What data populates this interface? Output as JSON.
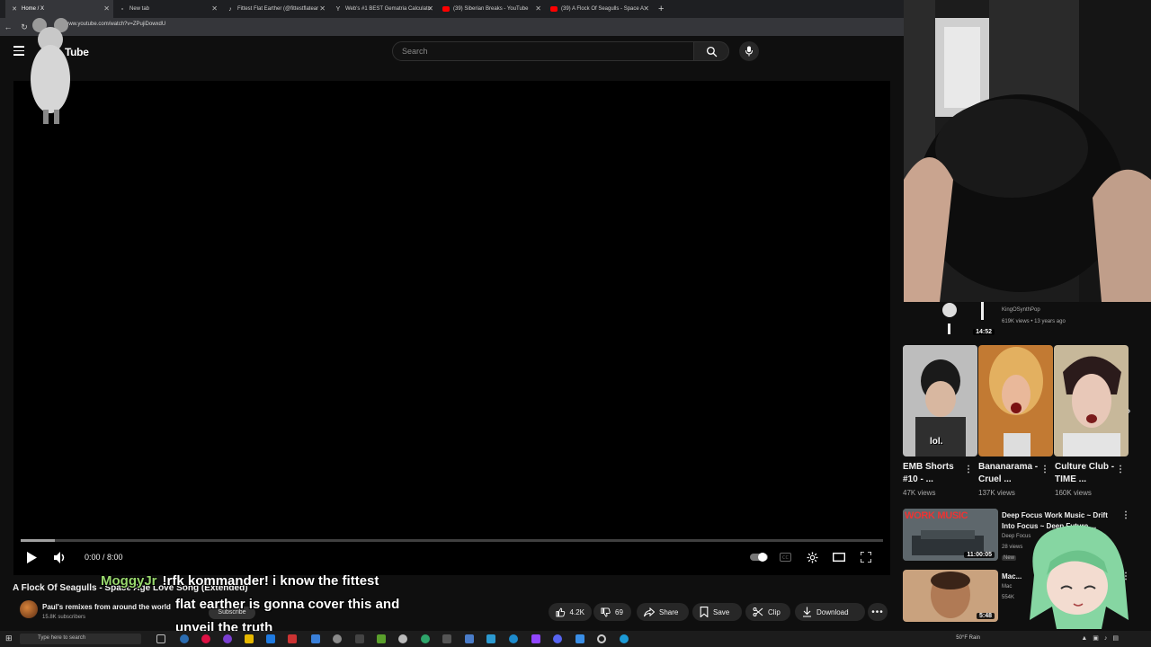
{
  "browser": {
    "tabs": [
      {
        "label": "Home / X",
        "icon": "x-logo-icon"
      },
      {
        "label": "New tab",
        "icon": "newtab-icon"
      },
      {
        "label": "Fittest Flat Earther (@fittestflatear",
        "icon": "tiktok-icon"
      },
      {
        "label": "Web's #1 BEST Gematria Calculato",
        "icon": "gematria-icon"
      },
      {
        "label": "(39) Siberian Breaks - YouTube",
        "icon": "youtube-icon"
      },
      {
        "label": "(39) A Flock Of Seagulls - Space A",
        "icon": "youtube-icon"
      }
    ],
    "active_tab": 5,
    "url": "www.youtube.com/watch?v=ZPujiDowxdU"
  },
  "youtube": {
    "logo": "Tube",
    "search_placeholder": "Search"
  },
  "player": {
    "time": "0:00 / 8:00",
    "progress_loaded_fraction": 0.04
  },
  "video": {
    "title": "A Flock Of Seagulls - Space Age Love Song (Extended)",
    "channel": "Paul's remixes from around the world",
    "subscribers": "15.8K subscribers",
    "subscribe_label": "Subscribe",
    "actions": {
      "likes": "4.2K",
      "dislikes": "69",
      "share": "Share",
      "save": "Save",
      "clip": "Clip",
      "download": "Download"
    }
  },
  "chat": {
    "user": "MoggyJr",
    "line1": "!rfk kommander! i know the fittest",
    "line2": "flat earther is gonna cover this and",
    "line3": "unveil the truth"
  },
  "sidebar": {
    "top_rec": {
      "channel": "KingOSynthPop",
      "meta": "619K views • 13 years ago",
      "duration": "14:52"
    },
    "shorts": [
      {
        "title": "EMB Shorts #10 - ...",
        "views": "47K views",
        "overlay": "lol."
      },
      {
        "title": "Bananarama - Cruel ...",
        "views": "137K views"
      },
      {
        "title": "Culture Club - TIME ...",
        "views": "160K views"
      }
    ],
    "recs": [
      {
        "title": "Deep Focus Work Music ~ Drift Into Focus ~ Deep Future ...",
        "channel": "Deep Focus",
        "meta": "28 views",
        "badge": "New",
        "duration": "11:00:05",
        "thumb_text": "WORK MUSIC"
      },
      {
        "title": "Mac...",
        "channel": "Mac",
        "meta": "554K",
        "duration": "5:48"
      }
    ]
  },
  "taskbar": {
    "search_placeholder": "Type here to search",
    "weather": "50°F Rain"
  }
}
